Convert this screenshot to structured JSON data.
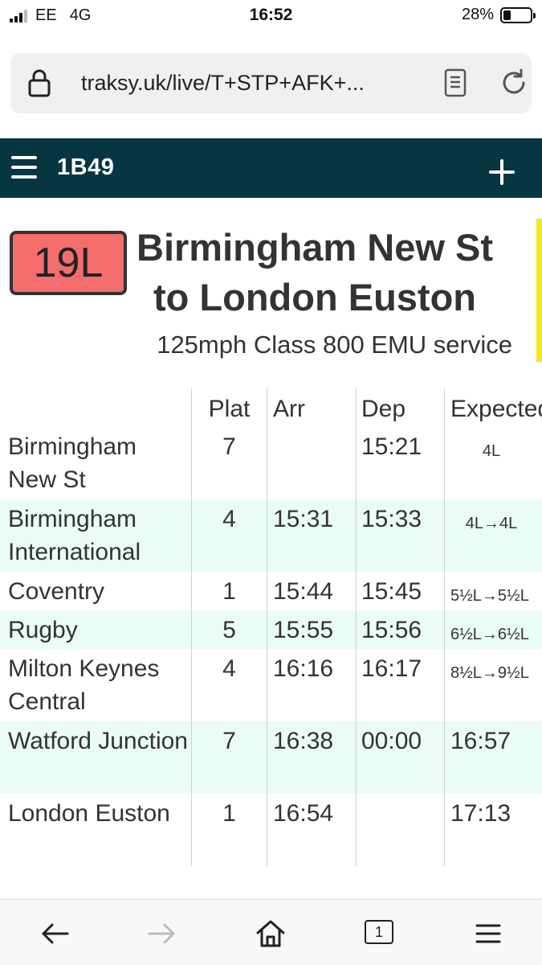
{
  "status": {
    "carrier": "EE",
    "network": "4G",
    "time": "16:52",
    "battery": "28%"
  },
  "browser": {
    "url": "traksy.uk/live/T+STP+AFK+..."
  },
  "header": {
    "headcode": "1B49"
  },
  "service": {
    "badge": "19L",
    "title_line1": "Birmingham New St",
    "title_line2": "to London Euston",
    "subtitle": "125mph Class 800 EMU service",
    "badge_color": "#f56d6d",
    "header_color": "#073642",
    "accent_bar_color": "#f3e61d"
  },
  "table": {
    "headers": {
      "plat": "Plat",
      "arr": "Arr",
      "dep": "Dep",
      "expected": "Expected"
    },
    "rows": [
      {
        "station": "Birmingham New St",
        "plat": "7",
        "arr": "",
        "dep": "15:21",
        "expected": "4L"
      },
      {
        "station": "Birmingham International",
        "plat": "4",
        "arr": "15:31",
        "dep": "15:33",
        "expected": "4L→4L"
      },
      {
        "station": "Coventry",
        "plat": "1",
        "arr": "15:44",
        "dep": "15:45",
        "expected": "5½L→5½L"
      },
      {
        "station": "Rugby",
        "plat": "5",
        "arr": "15:55",
        "dep": "15:56",
        "expected": "6½L→6½L"
      },
      {
        "station": "Milton Keynes Central",
        "plat": "4",
        "arr": "16:16",
        "dep": "16:17",
        "expected": "8½L→9½L"
      },
      {
        "station": "Watford Junction",
        "plat": "7",
        "arr": "16:38",
        "dep": "00:00",
        "expected": "16:57"
      },
      {
        "station": "London Euston",
        "plat": "1",
        "arr": "16:54",
        "dep": "",
        "expected": "17:13"
      }
    ]
  },
  "toolbar": {
    "tabs_count": "1"
  }
}
